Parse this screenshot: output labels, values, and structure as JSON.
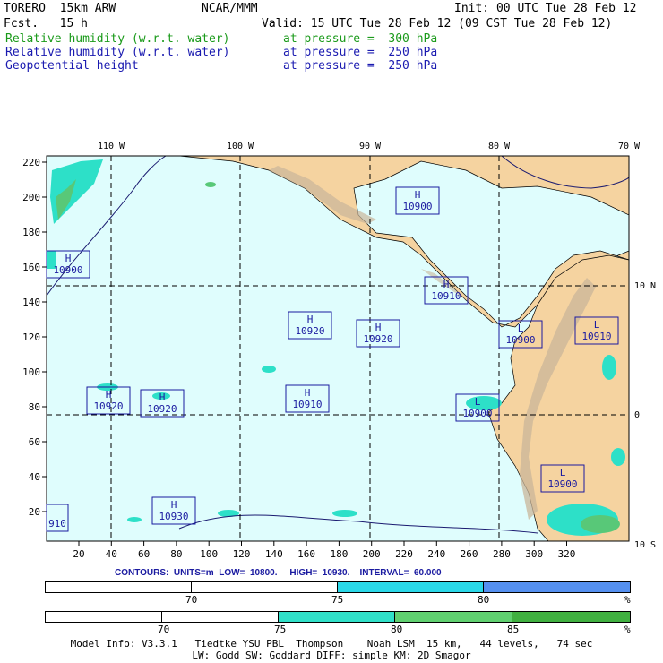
{
  "header": {
    "left_line1": "TORERO  15km ARW",
    "left_line2": "Fcst.   15 h",
    "center_line1": "NCAR/MMM",
    "init": "Init: 00 UTC Tue 28 Feb 12",
    "valid": "Valid: 15 UTC Tue 28 Feb 12 (09 CST Tue 28 Feb 12)",
    "field1_name": "Relative humidity (w.r.t. water)",
    "field1_level": "at pressure =  300 hPa",
    "field2_name": "Relative humidity (w.r.t. water)",
    "field2_level": "at pressure =  250 hPa",
    "field3_name": "Geopotential height",
    "field3_level": "at pressure =  250 hPa",
    "colors": {
      "field1": "#1a9a1a",
      "field2": "#1a1ab0",
      "field3": "#1a1ab0"
    }
  },
  "map": {
    "lon_labels": [
      "110 W",
      "100 W",
      "90 W",
      "80 W",
      "70 W"
    ],
    "lat_labels": [
      "10 N",
      "0",
      "10 S"
    ],
    "x_ticks": [
      "20",
      "40",
      "60",
      "80",
      "100",
      "120",
      "140",
      "160",
      "180",
      "200",
      "220",
      "240",
      "260",
      "280",
      "300",
      "320"
    ],
    "y_ticks": [
      "220",
      "200",
      "180",
      "160",
      "140",
      "120",
      "100",
      "80",
      "60",
      "40",
      "20"
    ],
    "centers": [
      {
        "type": "H",
        "value": "10900"
      },
      {
        "type": "H",
        "value": "10900"
      },
      {
        "type": "H",
        "value": "10910"
      },
      {
        "type": "H",
        "value": "10920"
      },
      {
        "type": "H",
        "value": "10920"
      },
      {
        "type": "L",
        "value": "10900"
      },
      {
        "type": "L",
        "value": "10910"
      },
      {
        "type": "H",
        "value": "10920"
      },
      {
        "type": "H",
        "value": "10920"
      },
      {
        "type": "H",
        "value": "10910"
      },
      {
        "type": "L",
        "value": "10900"
      },
      {
        "type": "L",
        "value": "10900"
      },
      {
        "type": "H",
        "value": "10930"
      },
      {
        "type": "",
        "value": "910"
      }
    ],
    "colors": {
      "ocean": "#dffdfd",
      "land": "#f5d3a0",
      "rh300_75": "#2de0c8",
      "rh300_80": "#58c878",
      "rh300_85": "#1ea540"
    }
  },
  "contours": "CONTOURS:  UNITS=m  LOW=  10800.     HIGH=  10930.    INTERVAL=  60.000",
  "colorbar1": {
    "labels": [
      "70",
      "75",
      "80",
      "%"
    ],
    "colors": [
      "#ffffff",
      "#ffffff",
      "#2ad8e8",
      "#5590f0"
    ]
  },
  "colorbar2": {
    "labels": [
      "70",
      "75",
      "80",
      "85",
      "%"
    ],
    "colors": [
      "#ffffff",
      "#ffffff",
      "#30e0c8",
      "#60d070",
      "#40b040"
    ]
  },
  "footer": {
    "line1": "Model Info: V3.3.1   Tiedtke YSU PBL  Thompson    Noah LSM  15 km,   44 levels,   74 sec",
    "line2": "LW: Godd SW: Goddard DIFF: simple KM: 2D Smagor"
  }
}
